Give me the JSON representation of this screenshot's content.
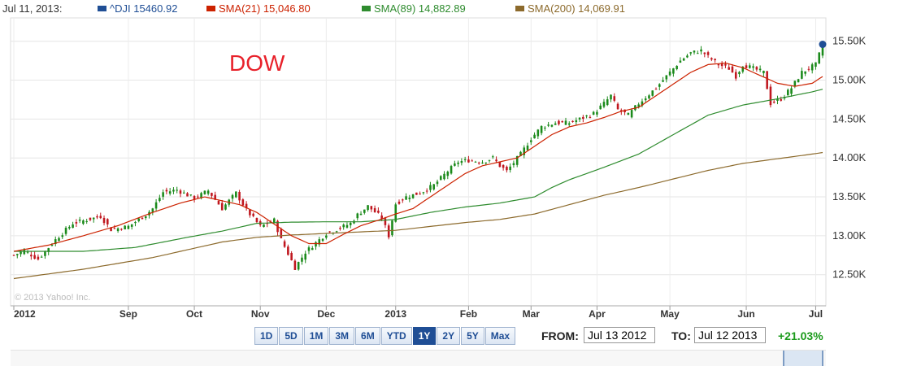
{
  "legend": {
    "date": "Jul 11, 2013:",
    "items": [
      {
        "label": "^DJI 15460.92",
        "color": "#1f4e95"
      },
      {
        "label": "SMA(21) 15,046.80",
        "color": "#cc2200"
      },
      {
        "label": "SMA(89) 14,882.89",
        "color": "#2f8c2f"
      },
      {
        "label": "SMA(200) 14,069.91",
        "color": "#8c6a2c"
      }
    ]
  },
  "overlay_label": "DOW",
  "watermark": "© 2013 Yahoo! Inc.",
  "range_buttons": [
    {
      "label": "1D",
      "active": false
    },
    {
      "label": "5D",
      "active": false
    },
    {
      "label": "1M",
      "active": false
    },
    {
      "label": "3M",
      "active": false
    },
    {
      "label": "6M",
      "active": false
    },
    {
      "label": "YTD",
      "active": false
    },
    {
      "label": "1Y",
      "active": true
    },
    {
      "label": "2Y",
      "active": false
    },
    {
      "label": "5Y",
      "active": false
    },
    {
      "label": "Max",
      "active": false
    }
  ],
  "date_range": {
    "from_label": "FROM:",
    "from_value": "Jul 13 2012",
    "to_label": "TO:",
    "to_value": "Jul 12 2013",
    "change": "+21.03%"
  },
  "colors": {
    "up": "#1b8a1b",
    "down": "#c0171f",
    "sma21": "#cc2200",
    "sma89": "#2f8c2f",
    "sma200": "#8c6a2c",
    "last_point": "#1f4e95"
  },
  "chart_data": {
    "type": "line",
    "title": "",
    "ylim": [
      12100,
      15800
    ],
    "y_ticks": [
      {
        "value": 12500,
        "label": "12.50K"
      },
      {
        "value": 13000,
        "label": "13.00K"
      },
      {
        "value": 13500,
        "label": "13.50K"
      },
      {
        "value": 14000,
        "label": "14.00K"
      },
      {
        "value": 14500,
        "label": "14.50K"
      },
      {
        "value": 15000,
        "label": "15.00K"
      },
      {
        "value": 15500,
        "label": "15.50K"
      }
    ],
    "x_ticks": [
      {
        "label": "2012",
        "index": 0
      },
      {
        "label": "Sep",
        "index": 33
      },
      {
        "label": "Oct",
        "index": 52
      },
      {
        "label": "Nov",
        "index": 71
      },
      {
        "label": "Dec",
        "index": 90
      },
      {
        "label": "2013",
        "index": 110
      },
      {
        "label": "Feb",
        "index": 131
      },
      {
        "label": "Mar",
        "index": 149
      },
      {
        "label": "Apr",
        "index": 168
      },
      {
        "label": "May",
        "index": 189
      },
      {
        "label": "Jun",
        "index": 211
      },
      {
        "label": "Jul",
        "index": 231
      }
    ],
    "close_series": {
      "name": "^DJI",
      "keypoints": [
        [
          0,
          12750
        ],
        [
          3,
          12810
        ],
        [
          7,
          12700
        ],
        [
          12,
          12950
        ],
        [
          17,
          13160
        ],
        [
          25,
          13250
        ],
        [
          28,
          13080
        ],
        [
          33,
          13120
        ],
        [
          38,
          13270
        ],
        [
          40,
          13350
        ],
        [
          43,
          13560
        ],
        [
          47,
          13590
        ],
        [
          52,
          13480
        ],
        [
          56,
          13580
        ],
        [
          60,
          13350
        ],
        [
          64,
          13550
        ],
        [
          67,
          13330
        ],
        [
          71,
          13120
        ],
        [
          75,
          13200
        ],
        [
          77,
          12950
        ],
        [
          81,
          12590
        ],
        [
          84,
          12790
        ],
        [
          88,
          12950
        ],
        [
          90,
          13030
        ],
        [
          94,
          13100
        ],
        [
          97,
          13160
        ],
        [
          99,
          13270
        ],
        [
          102,
          13380
        ],
        [
          106,
          13230
        ],
        [
          108,
          13000
        ],
        [
          110,
          13410
        ],
        [
          113,
          13500
        ],
        [
          117,
          13550
        ],
        [
          121,
          13650
        ],
        [
          125,
          13830
        ],
        [
          128,
          13950
        ],
        [
          131,
          13970
        ],
        [
          135,
          13950
        ],
        [
          138,
          14000
        ],
        [
          140,
          13900
        ],
        [
          142,
          13830
        ],
        [
          146,
          14050
        ],
        [
          149,
          14250
        ],
        [
          152,
          14400
        ],
        [
          156,
          14450
        ],
        [
          160,
          14450
        ],
        [
          163,
          14500
        ],
        [
          167,
          14570
        ],
        [
          170,
          14700
        ],
        [
          172,
          14800
        ],
        [
          174,
          14620
        ],
        [
          177,
          14550
        ],
        [
          180,
          14700
        ],
        [
          185,
          14900
        ],
        [
          189,
          15100
        ],
        [
          192,
          15250
        ],
        [
          195,
          15350
        ],
        [
          198,
          15380
        ],
        [
          200,
          15300
        ],
        [
          203,
          15200
        ],
        [
          206,
          15150
        ],
        [
          208,
          15050
        ],
        [
          210,
          15200
        ],
        [
          213,
          15150
        ],
        [
          216,
          15100
        ],
        [
          218,
          14700
        ],
        [
          221,
          14760
        ],
        [
          224,
          14900
        ],
        [
          227,
          15100
        ],
        [
          229,
          15150
        ],
        [
          231,
          15200
        ],
        [
          233,
          15460
        ]
      ]
    },
    "sma21": {
      "name": "SMA(21)",
      "keypoints": [
        [
          0,
          12800
        ],
        [
          10,
          12880
        ],
        [
          20,
          13000
        ],
        [
          30,
          13130
        ],
        [
          40,
          13300
        ],
        [
          48,
          13420
        ],
        [
          55,
          13500
        ],
        [
          60,
          13450
        ],
        [
          65,
          13400
        ],
        [
          70,
          13300
        ],
        [
          75,
          13150
        ],
        [
          80,
          13000
        ],
        [
          85,
          12900
        ],
        [
          90,
          12900
        ],
        [
          95,
          13020
        ],
        [
          100,
          13130
        ],
        [
          105,
          13200
        ],
        [
          110,
          13280
        ],
        [
          115,
          13350
        ],
        [
          120,
          13500
        ],
        [
          125,
          13650
        ],
        [
          130,
          13800
        ],
        [
          135,
          13900
        ],
        [
          140,
          13950
        ],
        [
          145,
          14000
        ],
        [
          150,
          14150
        ],
        [
          155,
          14300
        ],
        [
          160,
          14400
        ],
        [
          165,
          14450
        ],
        [
          170,
          14520
        ],
        [
          175,
          14600
        ],
        [
          180,
          14650
        ],
        [
          185,
          14800
        ],
        [
          190,
          14950
        ],
        [
          195,
          15100
        ],
        [
          200,
          15200
        ],
        [
          205,
          15220
        ],
        [
          210,
          15160
        ],
        [
          215,
          15060
        ],
        [
          220,
          14960
        ],
        [
          225,
          14920
        ],
        [
          230,
          14960
        ],
        [
          233,
          15046.8
        ]
      ]
    },
    "sma89": {
      "name": "SMA(89)",
      "keypoints": [
        [
          0,
          12800
        ],
        [
          20,
          12800
        ],
        [
          35,
          12850
        ],
        [
          50,
          12980
        ],
        [
          60,
          13060
        ],
        [
          70,
          13160
        ],
        [
          80,
          13175
        ],
        [
          90,
          13180
        ],
        [
          100,
          13180
        ],
        [
          110,
          13210
        ],
        [
          120,
          13300
        ],
        [
          130,
          13370
        ],
        [
          140,
          13420
        ],
        [
          150,
          13500
        ],
        [
          155,
          13620
        ],
        [
          160,
          13720
        ],
        [
          170,
          13880
        ],
        [
          180,
          14050
        ],
        [
          190,
          14300
        ],
        [
          200,
          14550
        ],
        [
          210,
          14680
        ],
        [
          220,
          14760
        ],
        [
          230,
          14850
        ],
        [
          233,
          14882.89
        ]
      ]
    },
    "sma200": {
      "name": "SMA(200)",
      "keypoints": [
        [
          0,
          12450
        ],
        [
          20,
          12570
        ],
        [
          40,
          12720
        ],
        [
          60,
          12920
        ],
        [
          70,
          12980
        ],
        [
          80,
          13010
        ],
        [
          90,
          13030
        ],
        [
          100,
          13050
        ],
        [
          110,
          13070
        ],
        [
          120,
          13120
        ],
        [
          130,
          13170
        ],
        [
          140,
          13210
        ],
        [
          150,
          13280
        ],
        [
          160,
          13400
        ],
        [
          170,
          13520
        ],
        [
          180,
          13620
        ],
        [
          190,
          13730
        ],
        [
          200,
          13840
        ],
        [
          210,
          13930
        ],
        [
          220,
          13990
        ],
        [
          230,
          14050
        ],
        [
          233,
          14069.91
        ]
      ]
    }
  }
}
